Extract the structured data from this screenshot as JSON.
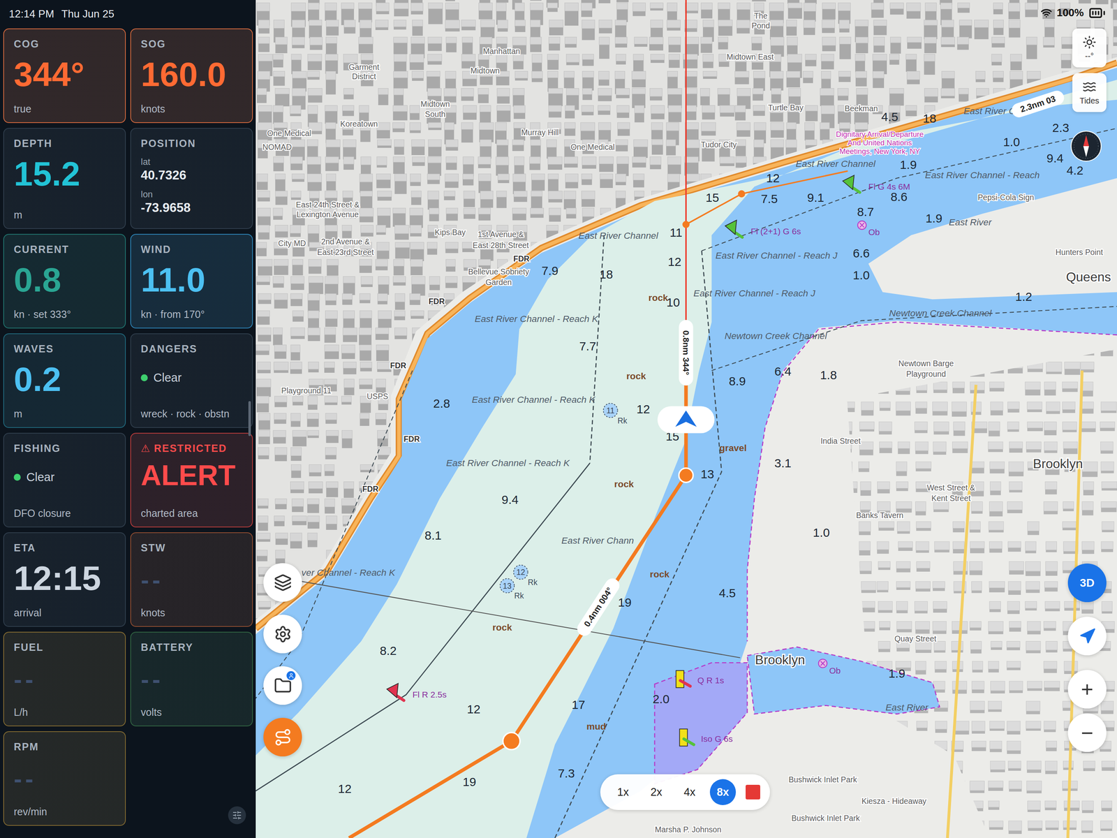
{
  "status_bar": {
    "time": "12:14 PM",
    "date": "Thu Jun 25",
    "battery": "100%"
  },
  "cards": [
    {
      "kind": "value",
      "label": "COG",
      "value": "344°",
      "unit": "true",
      "color": "#ff6a33",
      "accent": "#c8643c"
    },
    {
      "kind": "value",
      "label": "SOG",
      "value": "160.0",
      "unit": "knots",
      "color": "#ff6a33",
      "accent": "#c8643c"
    },
    {
      "kind": "value",
      "label": "DEPTH",
      "value": "15.2",
      "unit": "m",
      "color": "#22c3d6",
      "accent": "#2e3c4a"
    },
    {
      "kind": "position",
      "label": "POSITION",
      "lat_label": "lat",
      "lat": "40.7326",
      "lon_label": "lon",
      "lon": "-73.9658",
      "color": "#e8edf2",
      "accent": "#2e3c4a"
    },
    {
      "kind": "value",
      "label": "CURRENT",
      "value": "0.8",
      "unit": "kn · set 333°",
      "color": "#2aa593",
      "accent": "#1f6e6a"
    },
    {
      "kind": "value",
      "label": "WIND",
      "value": "11.0",
      "unit": "kn · from 170°",
      "color": "#4cc0f2",
      "accent": "#2b7eae"
    },
    {
      "kind": "value",
      "label": "WAVES",
      "value": "0.2",
      "unit": "m",
      "color": "#4cc0f2",
      "accent": "#1f6478"
    },
    {
      "kind": "status",
      "label": "DANGERS",
      "status": "Clear",
      "dot": "#3ecf6e",
      "unit": "wreck · rock · obstn",
      "color": "#c9d2dc",
      "accent": "#2e3c4a"
    },
    {
      "kind": "status",
      "label": "FISHING",
      "status": "Clear",
      "dot": "#3ecf6e",
      "unit": "DFO closure",
      "color": "#c9d2dc",
      "accent": "#2e3c4a"
    },
    {
      "kind": "alert",
      "label": "RESTRICTED",
      "icon": "⚠",
      "value": "ALERT",
      "unit": "charted area",
      "color": "#ff4b4b",
      "accent": "#b03a3a"
    },
    {
      "kind": "value",
      "label": "ETA",
      "value": "12:15",
      "unit": "arrival",
      "color": "#cdd6e0",
      "accent": "#2e3c4a"
    },
    {
      "kind": "empty",
      "label": "STW",
      "value": "--",
      "unit": "knots",
      "color": "#3f5170",
      "accent": "#8a4a30"
    },
    {
      "kind": "empty",
      "label": "FUEL",
      "value": "--",
      "unit": "L/h",
      "color": "#3f5170",
      "accent": "#7d6630"
    },
    {
      "kind": "empty",
      "label": "BATTERY",
      "value": "--",
      "unit": "volts",
      "color": "#3f5170",
      "accent": "#2f6040"
    },
    {
      "kind": "empty",
      "label": "RPM",
      "value": "--",
      "unit": "rev/min",
      "color": "#3f5170",
      "accent": "#7d6630"
    }
  ],
  "map": {
    "depths": [
      "15",
      "12",
      "7.5",
      "9.1",
      "8.6",
      "8.7",
      "11",
      "12",
      "10",
      "7.9",
      "18",
      "7.7",
      "12",
      "15",
      "13",
      "9.4",
      "8.1",
      "2.8",
      "19",
      "17",
      "2.0",
      "8.2",
      "12",
      "19",
      "7.3",
      "12",
      "8.9",
      "6.4",
      "1.8",
      "3.1",
      "1.0",
      "4.5",
      "1.9",
      "6.6",
      "1.0",
      "1.9",
      "1.2",
      "1.9",
      "1.0",
      "4.5",
      "18",
      "2.3",
      "9.4",
      "4.2"
    ],
    "seabed": [
      "rock",
      "rock",
      "rock",
      "rock",
      "rock",
      "gravel",
      "mud"
    ],
    "areas": [
      "East River Channel",
      "East River Channel - Reach K",
      "East River Channel - Reach K",
      "East River Channel - Reach K",
      "East River Chann",
      "ver Channel - Reach K",
      "East River Channel - Reach J",
      "East River Channel - Reach J",
      "Newtown Creek Channel",
      "Newtown Creek Channel",
      "East River",
      "East River Channel",
      "East River Channel - Reach",
      "East River Chan",
      "East River"
    ],
    "places": [
      {
        "text": "Brooklyn",
        "kind": "city"
      },
      {
        "text": "Brooklyn",
        "kind": "city"
      },
      {
        "text": "Queens",
        "kind": "city"
      },
      {
        "text": "Bushwick Inlet Park",
        "kind": "poi"
      },
      {
        "text": "Bushwick Inlet Park",
        "kind": "poi"
      },
      {
        "text": "Banks Tavern",
        "kind": "poi"
      },
      {
        "text": "West Street &",
        "kind": "poi"
      },
      {
        "text": "Kent Street",
        "kind": "poi"
      },
      {
        "text": "Quay Street",
        "kind": "poi"
      },
      {
        "text": "Kiesza - Hideaway",
        "kind": "poi"
      },
      {
        "text": "Marsha P. Johnson",
        "kind": "poi"
      },
      {
        "text": "Newtown Barge",
        "kind": "poi"
      },
      {
        "text": "Playground",
        "kind": "poi"
      },
      {
        "text": "India Street",
        "kind": "poi"
      },
      {
        "text": "Kips Bay",
        "kind": "poi"
      },
      {
        "text": "1st Avenue &",
        "kind": "poi"
      },
      {
        "text": "East 28th Street",
        "kind": "poi"
      },
      {
        "text": "2nd Avenue &",
        "kind": "poi"
      },
      {
        "text": "East 23rd Street",
        "kind": "poi"
      },
      {
        "text": "East 24th Street &",
        "kind": "poi"
      },
      {
        "text": "Lexington Avenue",
        "kind": "poi"
      },
      {
        "text": "Bellevue Sobriety",
        "kind": "poi"
      },
      {
        "text": "Garden",
        "kind": "poi"
      },
      {
        "text": "Playground 11",
        "kind": "poi"
      },
      {
        "text": "USPS",
        "kind": "poi"
      },
      {
        "text": "Tudor City",
        "kind": "poi"
      },
      {
        "text": "Turtle Bay",
        "kind": "poi"
      },
      {
        "text": "Murray Hill",
        "kind": "poi"
      },
      {
        "text": "Midtown",
        "kind": "poi"
      },
      {
        "text": "South",
        "kind": "poi"
      },
      {
        "text": "Koreatown",
        "kind": "poi"
      },
      {
        "text": "Garment",
        "kind": "poi"
      },
      {
        "text": "District",
        "kind": "poi"
      },
      {
        "text": "Manhattan",
        "kind": "poi"
      },
      {
        "text": "Midtown",
        "kind": "poi"
      },
      {
        "text": "Beekman",
        "kind": "poi"
      },
      {
        "text": "Midtown East",
        "kind": "poi"
      },
      {
        "text": "The",
        "kind": "poi"
      },
      {
        "text": "Pond",
        "kind": "poi"
      },
      {
        "text": "Pepsi-Cola Sign",
        "kind": "poi"
      },
      {
        "text": "Hunters Point",
        "kind": "poi"
      },
      {
        "text": "One Medical",
        "kind": "poi"
      },
      {
        "text": "One Medical",
        "kind": "poi"
      },
      {
        "text": "City MD",
        "kind": "poi"
      },
      {
        "text": "NOMAD",
        "kind": "poi"
      },
      {
        "text": "FDR",
        "kind": "road"
      },
      {
        "text": "FDR",
        "kind": "road"
      },
      {
        "text": "FDR",
        "kind": "road"
      },
      {
        "text": "FDR",
        "kind": "road"
      },
      {
        "text": "FDR",
        "kind": "road"
      }
    ],
    "notice": [
      "Dignitary Arrival/Departure",
      "And United Nations",
      "Meetings, New York, NY"
    ],
    "aids": [
      {
        "label": "Fl G 4s 6M",
        "kind": "buoy",
        "color": "#55c23a"
      },
      {
        "label": "Fl (2+1) G 6s",
        "kind": "buoy",
        "color": "#55c23a"
      },
      {
        "label": "Fl R 2.5s",
        "kind": "buoy",
        "color": "#e0334f"
      },
      {
        "label": "Q R 1s",
        "kind": "beacon",
        "color": "#e0334f"
      },
      {
        "label": "Iso G 6s",
        "kind": "beacon",
        "color": "#55c23a"
      }
    ],
    "rocks": [
      {
        "depth": "11",
        "label": "Rk"
      },
      {
        "depth": "12",
        "label": "Rk"
      },
      {
        "depth": "13",
        "label": "Rk"
      }
    ],
    "obstructions": [
      {
        "label": "Ob"
      },
      {
        "label": "Ob"
      }
    ],
    "route": {
      "legs": [
        "0.8nm 344°",
        "0.4nm 004°"
      ],
      "next_leg": "2.3nm 03"
    }
  },
  "map_controls": {
    "brightness": "--°",
    "tides": "Tides",
    "view": "3D",
    "zoom_in": "+",
    "zoom_out": "−"
  },
  "playback": {
    "speeds": [
      {
        "label": "1x",
        "selected": false
      },
      {
        "label": "2x",
        "selected": false
      },
      {
        "label": "4x",
        "selected": false
      },
      {
        "label": "8x",
        "selected": true
      }
    ]
  }
}
